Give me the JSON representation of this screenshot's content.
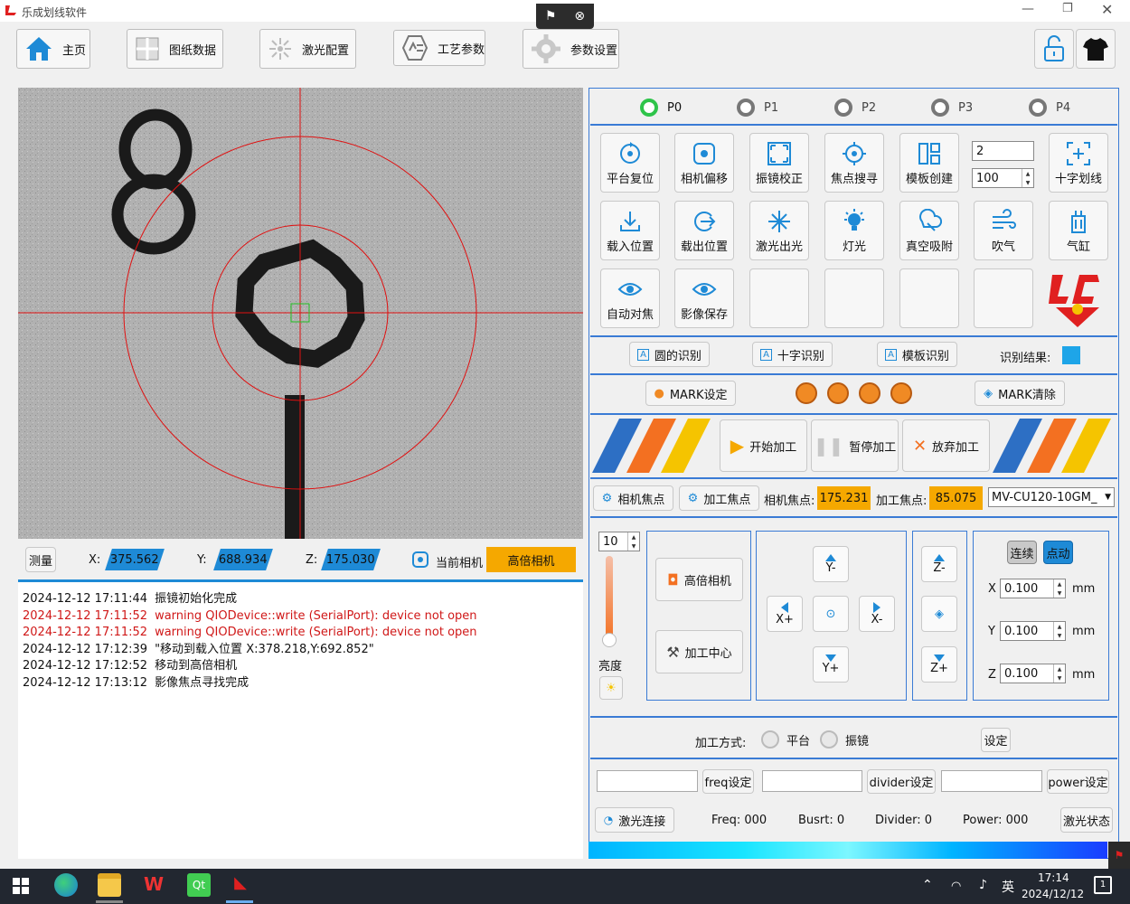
{
  "window": {
    "title": "乐成划线软件"
  },
  "toolbar": {
    "home": "主页",
    "drawing_data": "图纸数据",
    "laser_config": "激光配置",
    "process_params": "工艺参数",
    "param_settings": "参数设置"
  },
  "camera": {
    "measure": "测量",
    "x_label": "X:",
    "x_value": "375.562",
    "y_label": "Y:",
    "y_value": "688.934",
    "z_label": "Z:",
    "z_value": "175.030",
    "current_camera_label": "当前相机",
    "current_camera_value": "高倍相机",
    "overlay_digit_top": "8",
    "overlay_digit_bottom": "0"
  },
  "log": [
    {
      "time": "2024-12-12 17:11:44",
      "msg": "振镜初始化完成",
      "level": "info"
    },
    {
      "time": "2024-12-12 17:11:52",
      "msg": "warning QIODevice::write (SerialPort): device not open",
      "level": "warn"
    },
    {
      "time": "2024-12-12 17:11:52",
      "msg": "warning QIODevice::write (SerialPort): device not open",
      "level": "warn"
    },
    {
      "time": "2024-12-12 17:12:39",
      "msg": "\"移动到载入位置 X:378.218,Y:692.852\"",
      "level": "info"
    },
    {
      "time": "2024-12-12 17:12:52",
      "msg": "移动到高倍相机",
      "level": "info"
    },
    {
      "time": "2024-12-12 17:13:12",
      "msg": "影像焦点寻找完成",
      "level": "info"
    }
  ],
  "positions": [
    "P0",
    "P1",
    "P2",
    "P3",
    "P4"
  ],
  "tools": {
    "platform_reset": "平台复位",
    "camera_offset": "相机偏移",
    "galvo_calib": "振镜校正",
    "focus_search": "焦点搜寻",
    "template_create": "模板创建",
    "cross_line": "十字划线",
    "load_position": "载入位置",
    "unload_position": "载出位置",
    "laser_out": "激光出光",
    "light": "灯光",
    "vacuum": "真空吸附",
    "blow": "吹气",
    "cylinder": "气缸",
    "auto_focus": "自动对焦",
    "image_save": "影像保存",
    "spin_top_value": "2",
    "spin_bottom_value": "100"
  },
  "recognition": {
    "circle": "圆的识别",
    "cross": "十字识别",
    "template": "模板识别",
    "result_label": "识别结果:",
    "result_color": "#1ea5e8"
  },
  "mark": {
    "set": "MARK设定",
    "clear": "MARK清除",
    "dot_count": 4
  },
  "process": {
    "start": "开始加工",
    "pause": "暂停加工",
    "abort": "放弃加工"
  },
  "focus": {
    "camera_focus_btn": "相机焦点",
    "process_focus_btn": "加工焦点",
    "camera_focus_label": "相机焦点:",
    "camera_focus_value": "175.231",
    "process_focus_label": "加工焦点:",
    "process_focus_value": "85.075",
    "camera_model": "MV-CU120-10GM_"
  },
  "motion": {
    "brightness_value": "10",
    "brightness_label": "亮度",
    "high_cam": "高倍相机",
    "process_center": "加工中心",
    "y_minus": "Y-",
    "y_plus": "Y+",
    "x_plus": "X+",
    "x_minus": "X-",
    "z_minus": "Z-",
    "z_plus": "Z+",
    "continuous": "连续",
    "jog": "点动",
    "x_label": "X",
    "x_step": "0.100",
    "y_label": "Y",
    "y_step": "0.100",
    "z_label": "Z",
    "z_step": "0.100",
    "unit": "mm"
  },
  "mode": {
    "label": "加工方式:",
    "platform": "平台",
    "galvo": "振镜",
    "set": "设定"
  },
  "laser": {
    "freq_btn": "freq设定",
    "divider_btn": "divider设定",
    "power_btn": "power设定",
    "connect": "激光连接",
    "freq_status": "Freq: 000",
    "burst_status": "Busrt: 0",
    "divider_status": "Divider: 0",
    "power_status": "Power: 000",
    "state_btn": "激光状态"
  },
  "taskbar": {
    "lang": "英",
    "time": "17:14",
    "date": "2024/12/12",
    "notify_count": "1"
  }
}
